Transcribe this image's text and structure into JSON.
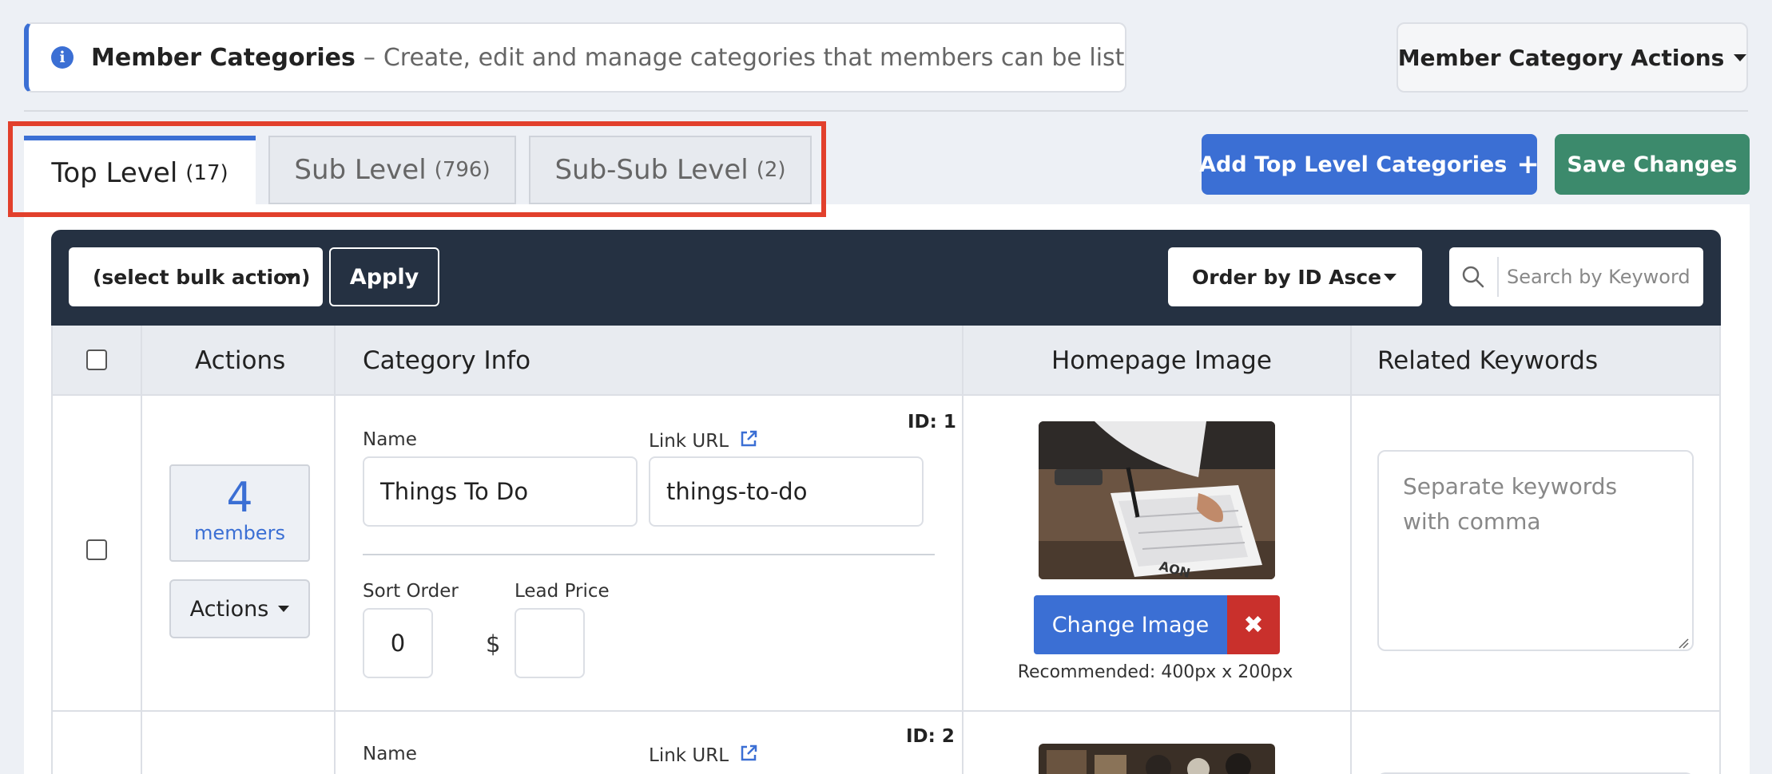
{
  "header": {
    "title": "Member Categories",
    "dash": "–",
    "description": "Create, edit and manage categories that members can be listed in",
    "actions_label": "Member Category Actions"
  },
  "tabs": [
    {
      "label": "Top Level",
      "count": "(17)",
      "active": true
    },
    {
      "label": "Sub Level",
      "count": "(796)",
      "active": false
    },
    {
      "label": "Sub-Sub Level",
      "count": "(2)",
      "active": false
    }
  ],
  "buttons": {
    "add": "Add Top Level Categories",
    "save": "Save Changes"
  },
  "toolbar": {
    "bulk_action": "(select bulk action)",
    "apply": "Apply",
    "order_by": "Order by ID Ascending",
    "search_placeholder": "Search by Keyword"
  },
  "columns": [
    "Actions",
    "Category Info",
    "Homepage Image",
    "Related Keywords"
  ],
  "rows": [
    {
      "id": "ID: 1",
      "members_count": "4",
      "members_label": "members",
      "actions_label": "Actions",
      "name_label": "Name",
      "name": "Things To Do",
      "link_label": "Link URL",
      "link": "things-to-do",
      "sort_label": "Sort Order",
      "sort": "0",
      "price_label": "Lead Price",
      "currency": "$",
      "price": "",
      "change_image": "Change Image",
      "remove_icon": "✖",
      "recommended": "Recommended: 400px x 200px",
      "keywords_placeholder": "Separate keywords with comma"
    },
    {
      "id": "ID: 2",
      "name_label": "Name",
      "link_label": "Link URL"
    }
  ],
  "colors": {
    "primary": "#3b6fd4",
    "success": "#3c8a6c",
    "danger": "#c9302c",
    "toolbar": "#253142",
    "highlight": "#e2402c"
  }
}
